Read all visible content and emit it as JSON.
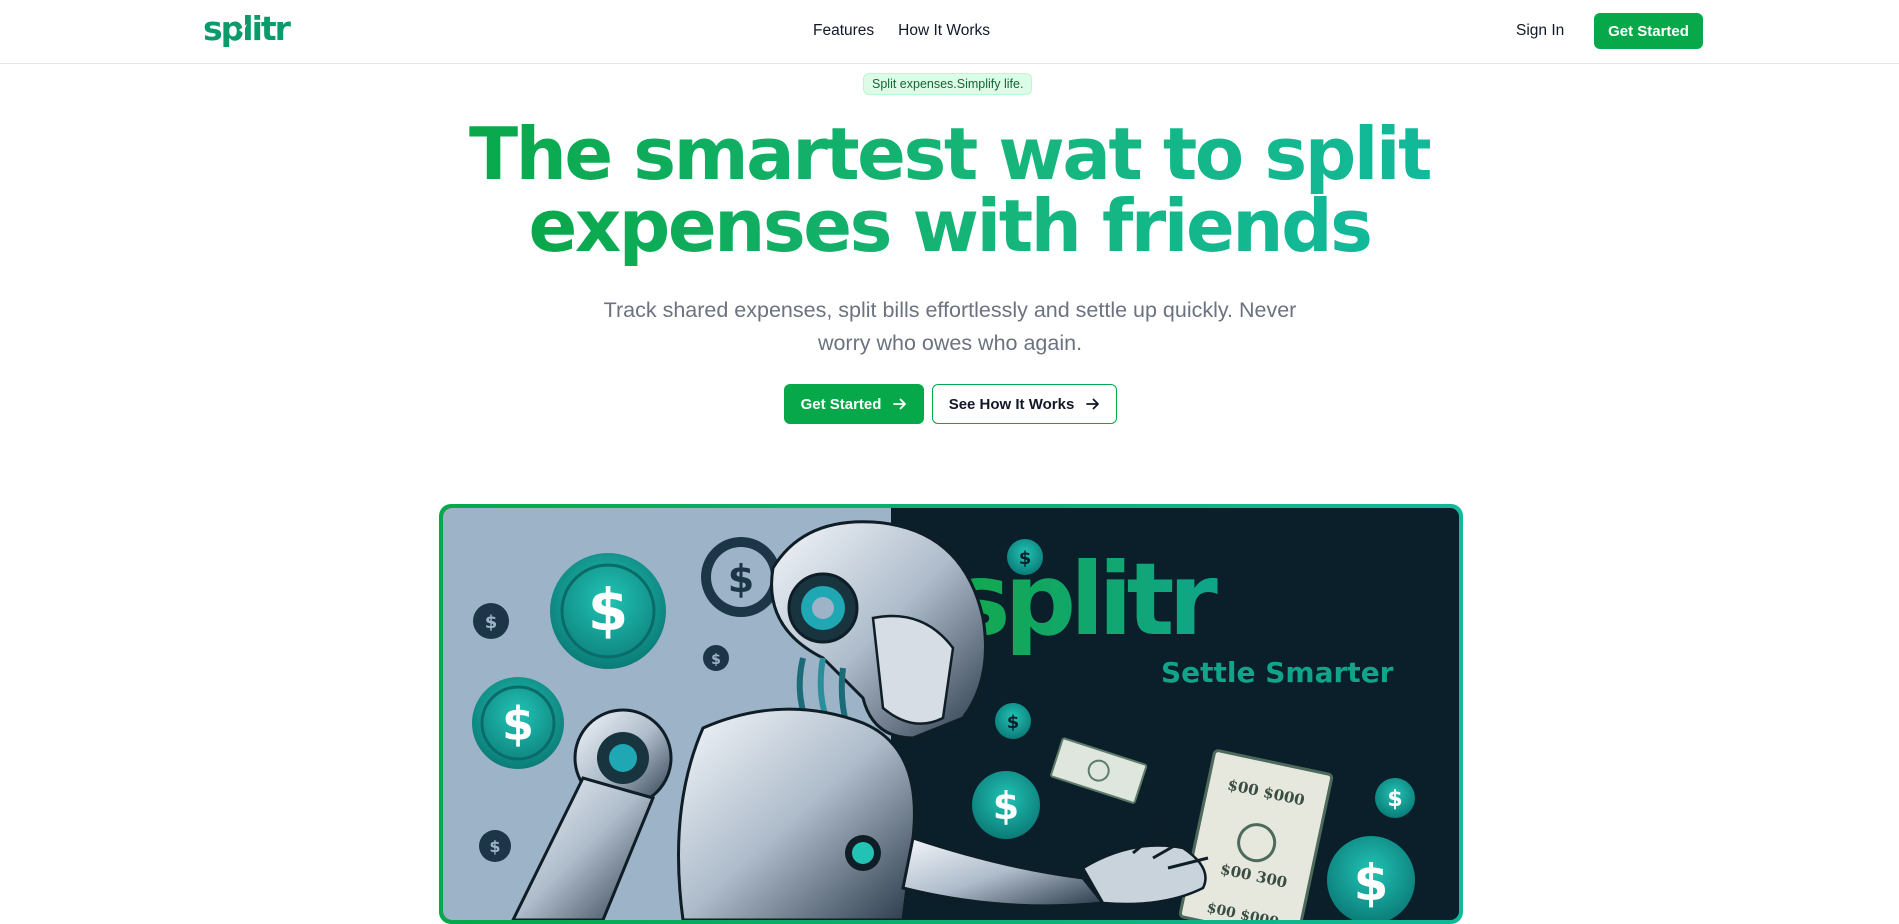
{
  "brand": {
    "name": "splitr",
    "primary_color": "#06a84a",
    "accent_color": "#12b99a"
  },
  "nav": {
    "links": [
      "Features",
      "How It Works"
    ],
    "sign_in": "Sign In",
    "cta": "Get Started"
  },
  "hero": {
    "badge": "Split expenses.Simplify life.",
    "headline_line1": "The smartest wat to split",
    "headline_line2": "expenses with friends",
    "subtext": "Track shared expenses, split bills effortlessly and settle up quickly. Never worry who owes who again.",
    "primary_button": "Get Started",
    "secondary_button": "See How It Works",
    "arrow_icon": "arrow-right-icon"
  },
  "hero_image": {
    "logo_text": "splitr",
    "tagline": "Settle Smarter",
    "bill_text_1": "$00 $000",
    "bill_text_2": "$00 300",
    "bill_text_3": "$00 $000",
    "coin_symbol": "$"
  }
}
